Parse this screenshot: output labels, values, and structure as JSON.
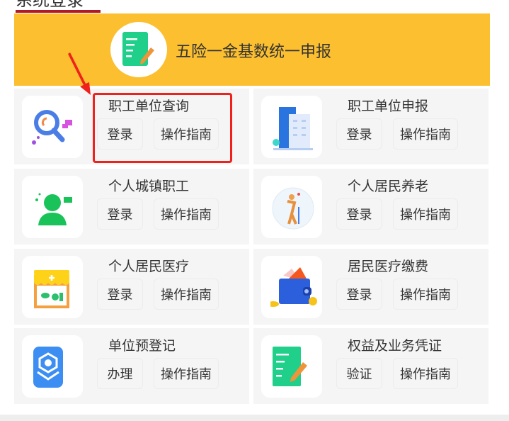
{
  "section_title": "系统登录",
  "banner": {
    "label": "五险一金基数统一申报",
    "icon": "notepad-pencil-icon"
  },
  "services": [
    {
      "title": "职工单位查询",
      "icon": "magnifier-icon",
      "buttons": [
        "登录",
        "操作指南"
      ]
    },
    {
      "title": "职工单位申报",
      "icon": "building-icon",
      "buttons": [
        "登录",
        "操作指南"
      ]
    },
    {
      "title": "个人城镇职工",
      "icon": "worker-icon",
      "buttons": [
        "登录",
        "操作指南"
      ]
    },
    {
      "title": "个人居民养老",
      "icon": "elderly-icon",
      "buttons": [
        "登录",
        "操作指南"
      ]
    },
    {
      "title": "个人居民医疗",
      "icon": "pharmacy-icon",
      "buttons": [
        "登录",
        "操作指南"
      ]
    },
    {
      "title": "居民医疗缴费",
      "icon": "wallet-icon",
      "buttons": [
        "登录",
        "操作指南"
      ]
    },
    {
      "title": "单位预登记",
      "icon": "gear-box-icon",
      "buttons": [
        "办理",
        "操作指南"
      ]
    },
    {
      "title": "权益及业务凭证",
      "icon": "notepad-pencil-icon",
      "buttons": [
        "验证",
        "操作指南"
      ]
    }
  ],
  "colors": {
    "banner": "#fbbf2f",
    "highlight": "#f0201c",
    "underline": "#b0182c"
  }
}
